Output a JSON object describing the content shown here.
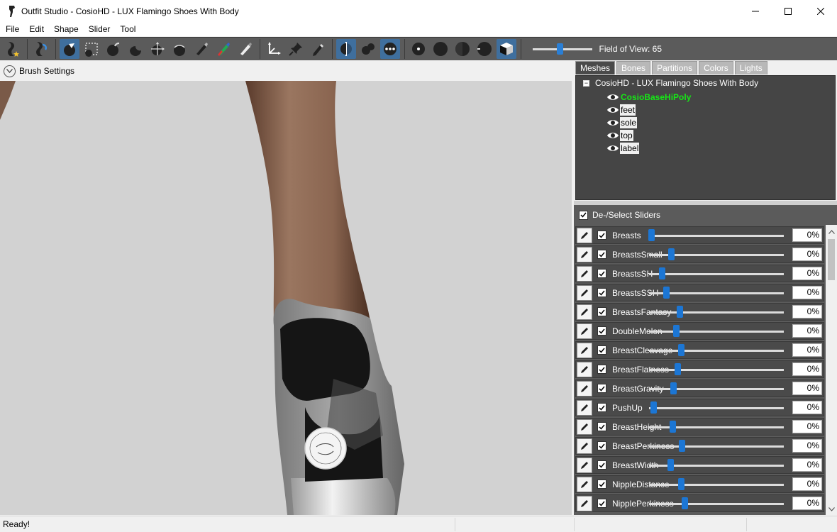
{
  "window": {
    "title": "Outfit Studio - CosioHD - LUX Flamingo Shoes With Body",
    "minimize_icon": "minimize-icon",
    "maximize_icon": "maximize-icon",
    "close_icon": "close-icon"
  },
  "menu": [
    "File",
    "Edit",
    "Shape",
    "Slider",
    "Tool"
  ],
  "toolbar": {
    "fov_label": "Field of View: 65",
    "fov_value": 65
  },
  "brush_settings": {
    "label": "Brush Settings"
  },
  "tabs": [
    {
      "label": "Meshes",
      "active": true
    },
    {
      "label": "Bones",
      "active": false
    },
    {
      "label": "Partitions",
      "active": false
    },
    {
      "label": "Colors",
      "active": false
    },
    {
      "label": "Lights",
      "active": false
    }
  ],
  "mesh_tree": {
    "root": "CosioHD - LUX Flamingo Shoes With Body",
    "items": [
      {
        "name": "CosioBaseHiPoly",
        "active": true
      },
      {
        "name": "feet",
        "active": false
      },
      {
        "name": "sole",
        "active": false
      },
      {
        "name": "top",
        "active": false
      },
      {
        "name": "label",
        "active": false
      }
    ]
  },
  "sliders_header": {
    "label": "De-/Select Sliders",
    "checked": true
  },
  "sliders": [
    {
      "name": "Breasts",
      "value": "0%",
      "checked": true
    },
    {
      "name": "BreastsSmall",
      "value": "0%",
      "checked": true
    },
    {
      "name": "BreastsSH",
      "value": "0%",
      "checked": true
    },
    {
      "name": "BreastsSSH",
      "value": "0%",
      "checked": true
    },
    {
      "name": "BreastsFantasy",
      "value": "0%",
      "checked": true
    },
    {
      "name": "DoubleMelon",
      "value": "0%",
      "checked": true
    },
    {
      "name": "BreastCleavage",
      "value": "0%",
      "checked": true
    },
    {
      "name": "BreastFlatness",
      "value": "0%",
      "checked": true
    },
    {
      "name": "BreastGravity",
      "value": "0%",
      "checked": true
    },
    {
      "name": "PushUp",
      "value": "0%",
      "checked": true
    },
    {
      "name": "BreastHeight",
      "value": "0%",
      "checked": true
    },
    {
      "name": "BreastPerkiness",
      "value": "0%",
      "checked": true
    },
    {
      "name": "BreastWidth",
      "value": "0%",
      "checked": true
    },
    {
      "name": "NippleDistance",
      "value": "0%",
      "checked": true
    },
    {
      "name": "NipplePerkiness",
      "value": "0%",
      "checked": true
    }
  ],
  "status": {
    "text": "Ready!"
  },
  "colors": {
    "accent": "#1c76d4",
    "active_mesh": "#16e616",
    "panel_dark": "#454545",
    "toolbar": "#5b5b5b"
  }
}
